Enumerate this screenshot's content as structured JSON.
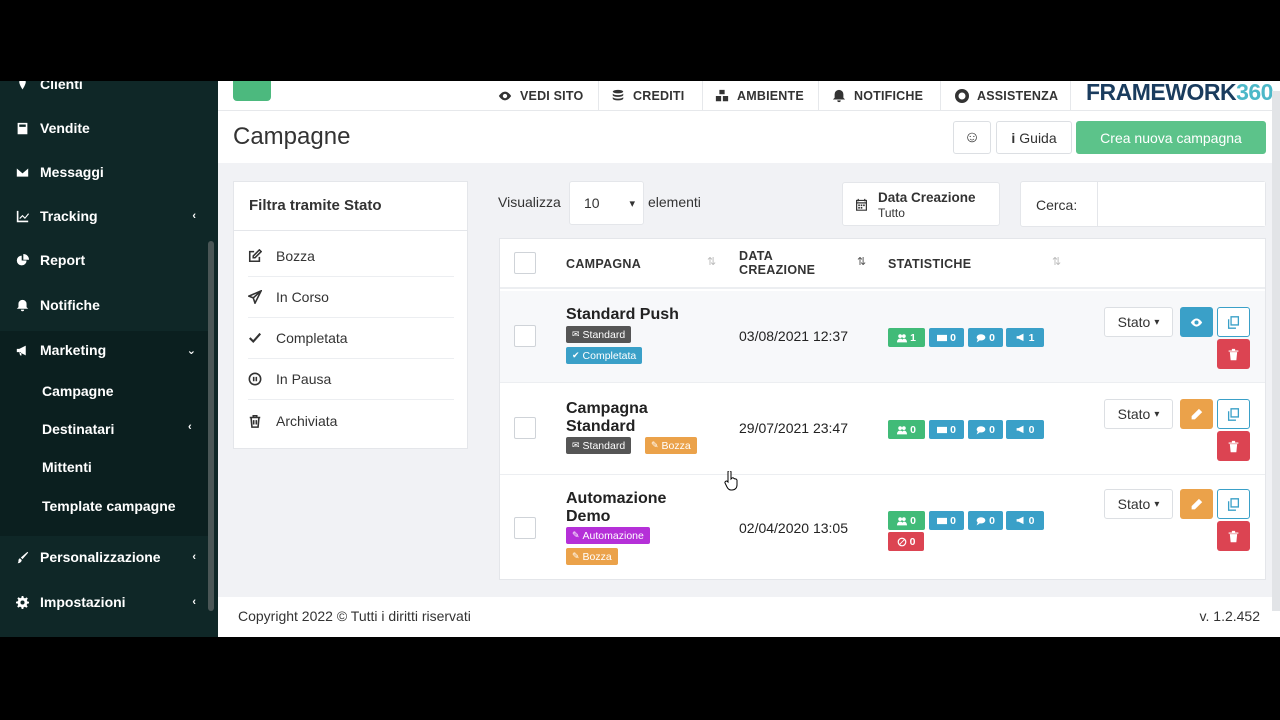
{
  "sidebar": {
    "items": [
      {
        "label": "Clienti",
        "icon": "pin-icon"
      },
      {
        "label": "Vendite",
        "icon": "calculator-icon"
      },
      {
        "label": "Messaggi",
        "icon": "envelope-icon"
      },
      {
        "label": "Tracking",
        "icon": "chart-line-icon",
        "has_children": true
      },
      {
        "label": "Report",
        "icon": "pie-chart-icon"
      },
      {
        "label": "Notifiche",
        "icon": "bell-icon"
      },
      {
        "label": "Marketing",
        "icon": "megaphone-icon",
        "expanded": true
      },
      {
        "label": "Personalizzazione",
        "icon": "brush-icon",
        "has_children": true
      },
      {
        "label": "Impostazioni",
        "icon": "gear-icon",
        "has_children": true
      }
    ],
    "marketing_sub": [
      "Campagne",
      "Destinatari",
      "Mittenti",
      "Template campagne"
    ]
  },
  "topbar": {
    "links": [
      "VEDI SITO",
      "CREDITI",
      "AMBIENTE",
      "NOTIFICHE",
      "ASSISTENZA"
    ],
    "logo_a": "FRAMEWORK",
    "logo_b": "360"
  },
  "header": {
    "title": "Campagne",
    "guide_label": "Guida",
    "create_label": "Crea nuova campagna"
  },
  "filter": {
    "title": "Filtra tramite Stato",
    "items": [
      "Bozza",
      "In Corso",
      "Completata",
      "In Pausa",
      "Archiviata"
    ]
  },
  "controls": {
    "show_label": "Visualizza",
    "page_length": "10",
    "elements_label": "elementi",
    "date_filter_title": "Data Creazione",
    "date_filter_value": "Tutto",
    "search_label": "Cerca:",
    "search_value": ""
  },
  "table": {
    "columns": [
      "CAMPAGNA",
      "DATA",
      "CREAZIONE",
      "STATISTICHE"
    ],
    "rows": [
      {
        "name_line1": "Standard Push",
        "name_line2": "",
        "badges": [
          "Standard",
          "Completata"
        ],
        "date": "03/08/2021 12:37",
        "stats": [
          "1",
          "0",
          "0",
          "1"
        ],
        "stato": "Stato"
      },
      {
        "name_line1": "Campagna",
        "name_line2": "Standard",
        "badges": [
          "Standard",
          "Bozza"
        ],
        "date": "29/07/2021 23:47",
        "stats": [
          "0",
          "0",
          "0",
          "0"
        ],
        "stato": "Stato"
      },
      {
        "name_line1": "Automazione",
        "name_line2": "Demo",
        "badges": [
          "Automazione",
          "Bozza"
        ],
        "date": "02/04/2020 13:05",
        "stats": [
          "0",
          "0",
          "0",
          "0",
          "0"
        ],
        "stato": "Stato"
      }
    ]
  },
  "footer": {
    "copyright": "Copyright 2022 © Tutti i diritti riservati",
    "version": "v. 1.2.452"
  },
  "colors": {
    "sidebar": "#0f2727",
    "accent_green": "#5cc38a",
    "info_blue": "#3aa0c8",
    "warning_orange": "#eba24a",
    "danger_red": "#dc4452",
    "purple": "#b530d8"
  }
}
